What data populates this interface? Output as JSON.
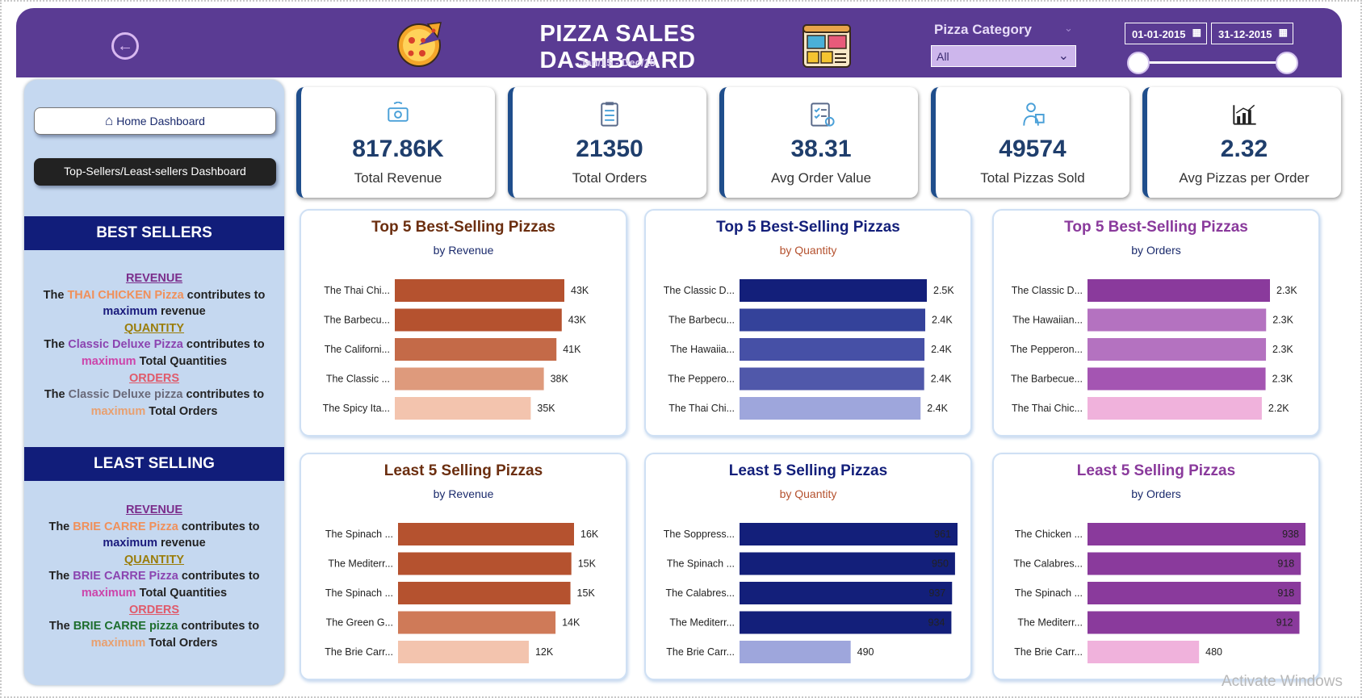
{
  "header": {
    "title": "PIZZA SALES DASHBOARD",
    "subtitle": "Jan/15 - Dec/15",
    "category_label": "Pizza Category",
    "category_value": "All",
    "date_start": "01-01-2015",
    "date_end": "31-12-2015",
    "accent": "#5a3b93"
  },
  "sidebar": {
    "home_label": "Home Dashboard",
    "top_label": "Top-Sellers/Least-sellers Dashboard",
    "best": {
      "heading": "BEST SELLERS",
      "revenue_head": "REVENUE",
      "revenue_pre": "The ",
      "revenue_name": "THAI CHICKEN Pizza",
      "revenue_post": " contributes to",
      "revenue_max": "maximum",
      "revenue_tail": " revenue",
      "qty_head": "QUANTITY",
      "qty_pre": "The ",
      "qty_name": "Classic Deluxe Pizza",
      "qty_post": " contributes to",
      "qty_max": "maximum",
      "qty_tail": " Total Quantities",
      "ord_head": "ORDERS",
      "ord_pre": "The ",
      "ord_name": "Classic Deluxe pizza",
      "ord_post": " contributes to",
      "ord_max": "maximum",
      "ord_tail": " Total Orders"
    },
    "least": {
      "heading": "LEAST SELLING",
      "revenue_head": "REVENUE",
      "revenue_pre": "The ",
      "revenue_name": "BRIE CARRE Pizza",
      "revenue_post": " contributes to",
      "revenue_max": "maximum",
      "revenue_tail": " revenue",
      "qty_head": "QUANTITY",
      "qty_pre": "The ",
      "qty_name": "BRIE CARRE Pizza",
      "qty_post": " contributes to",
      "qty_max": "maximum",
      "qty_tail": " Total Quantities",
      "ord_head": "ORDERS",
      "ord_pre": "The ",
      "ord_name": "BRIE CARRE pizza",
      "ord_post": " contributes to",
      "ord_max": "maximum",
      "ord_tail": " Total Orders"
    }
  },
  "kpis": [
    {
      "value": "817.86K",
      "label": "Total Revenue",
      "icon": "money-icon"
    },
    {
      "value": "21350",
      "label": "Total Orders",
      "icon": "clipboard-icon"
    },
    {
      "value": "38.31",
      "label": "Avg Order Value",
      "icon": "checklist-icon"
    },
    {
      "value": "49574",
      "label": "Total Pizzas Sold",
      "icon": "delivery-icon"
    },
    {
      "value": "2.32",
      "label": "Avg Pizzas per Order",
      "icon": "chart-icon"
    }
  ],
  "watermark": "Activate Windows",
  "chart_data": [
    {
      "type": "bar",
      "title": "Top 5 Best-Selling Pizzas",
      "subtitle": "by Revenue",
      "categories": [
        "The Thai Chi...",
        "The Barbecu...",
        "The Californi...",
        "The Classic ...",
        "The Spicy Ita..."
      ],
      "values": [
        43434,
        42768,
        41410,
        38180,
        34831
      ],
      "labels": [
        "43K",
        "43K",
        "41K",
        "38K",
        "35K"
      ],
      "colors": [
        "#b5522f",
        "#b5522f",
        "#c46a48",
        "#de9a7c",
        "#f3c4ae"
      ],
      "title_color": "#6b2e0f",
      "sub_color": "#1a2a6c"
    },
    {
      "type": "bar",
      "title": "Top 5 Best-Selling Pizzas",
      "subtitle": "by Quantity",
      "categories": [
        "The Classic D...",
        "The Barbecu...",
        "The Hawaiia...",
        "The Peppero...",
        "The Thai Chi..."
      ],
      "values": [
        2453,
        2432,
        2422,
        2418,
        2371
      ],
      "labels": [
        "2.5K",
        "2.4K",
        "2.4K",
        "2.4K",
        "2.4K"
      ],
      "colors": [
        "#131f7a",
        "#34429a",
        "#4650a6",
        "#5058aa",
        "#9ea6dc"
      ],
      "title_color": "#131f7a",
      "sub_color": "#b5522f"
    },
    {
      "type": "bar",
      "title": "Top 5 Best-Selling Pizzas",
      "subtitle": "by Orders",
      "categories": [
        "The Classic D...",
        "The Hawaiian...",
        "The Pepperon...",
        "The Barbecue...",
        "The Thai Chic..."
      ],
      "values": [
        2329,
        2280,
        2278,
        2273,
        2225
      ],
      "labels": [
        "2.3K",
        "2.3K",
        "2.3K",
        "2.3K",
        "2.2K"
      ],
      "colors": [
        "#8a3a9c",
        "#b472c0",
        "#b472c0",
        "#a455b2",
        "#f0b2dc"
      ],
      "title_color": "#8a3a9c",
      "sub_color": "#1a2a6c"
    },
    {
      "type": "bar",
      "title": "Least 5 Selling Pizzas",
      "subtitle": "by Revenue",
      "categories": [
        "The Spinach ...",
        "The Mediterr...",
        "The Spinach ...",
        "The Green G...",
        "The Brie Carr..."
      ],
      "values": [
        15596,
        15360,
        15278,
        13956,
        11588
      ],
      "labels": [
        "16K",
        "15K",
        "15K",
        "14K",
        "12K"
      ],
      "colors": [
        "#b5522f",
        "#b5522f",
        "#b5522f",
        "#cf7a58",
        "#f3c4ae"
      ],
      "title_color": "#6b2e0f",
      "sub_color": "#1a2a6c"
    },
    {
      "type": "bar",
      "title": "Least 5 Selling Pizzas",
      "subtitle": "by Quantity",
      "categories": [
        "The Soppress...",
        "The Spinach ...",
        "The Calabres...",
        "The Mediterr...",
        "The Brie Carr..."
      ],
      "values": [
        961,
        950,
        937,
        934,
        490
      ],
      "labels": [
        "961",
        "950",
        "937",
        "934",
        "490"
      ],
      "colors": [
        "#131f7a",
        "#131f7a",
        "#131f7a",
        "#131f7a",
        "#9ea6dc"
      ],
      "title_color": "#131f7a",
      "sub_color": "#b5522f"
    },
    {
      "type": "bar",
      "title": "Least 5 Selling Pizzas",
      "subtitle": "by Orders",
      "categories": [
        "The Chicken ...",
        "The Calabres...",
        "The Spinach ...",
        "The Mediterr...",
        "The Brie Carr..."
      ],
      "values": [
        938,
        918,
        918,
        912,
        480
      ],
      "labels": [
        "938",
        "918",
        "918",
        "912",
        "480"
      ],
      "colors": [
        "#8a3a9c",
        "#8a3a9c",
        "#8a3a9c",
        "#8a3a9c",
        "#f0b2dc"
      ],
      "title_color": "#8a3a9c",
      "sub_color": "#1a2a6c"
    }
  ]
}
